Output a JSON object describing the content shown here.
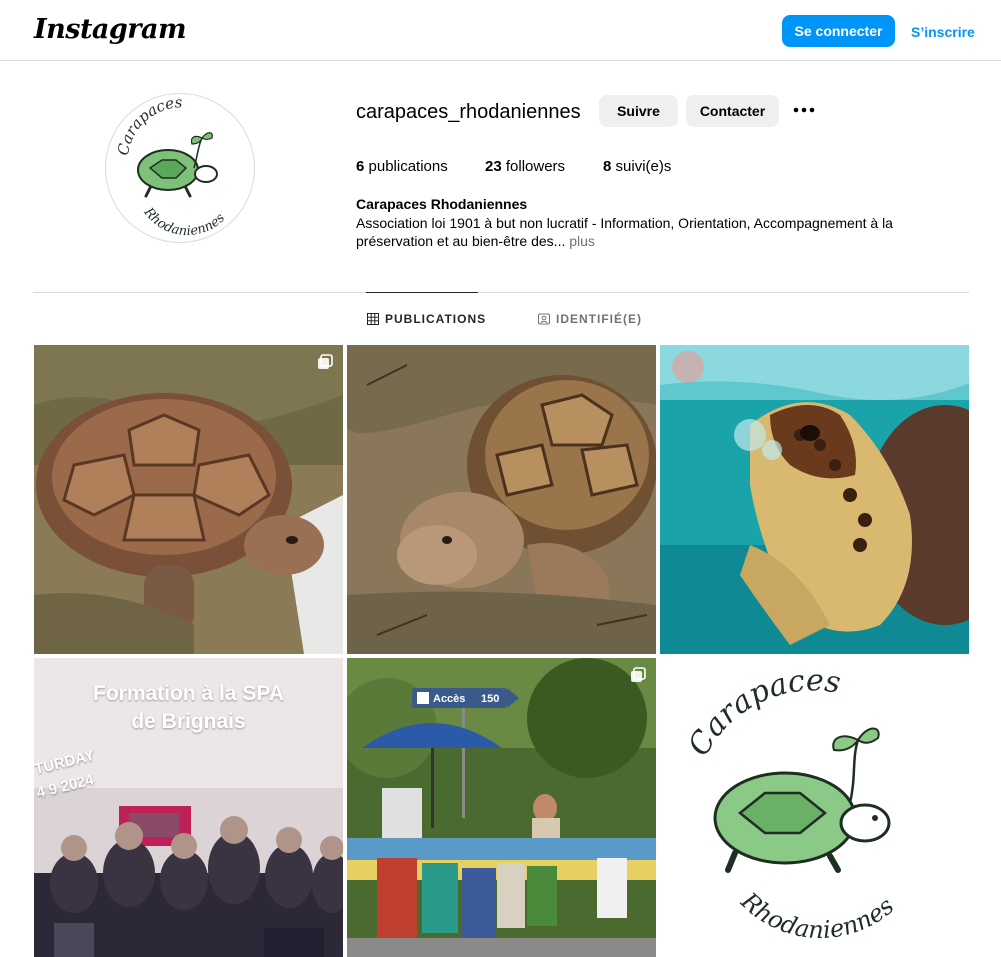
{
  "nav": {
    "logo": "Instagram",
    "login_label": "Se connecter",
    "signup_label": "S’inscrire",
    "accent_color": "#0095f6"
  },
  "profile": {
    "username": "carapaces_rhodaniennes",
    "follow_label": "Suivre",
    "contact_label": "Contacter",
    "more_icon": "more-horizontal-icon",
    "stats": {
      "posts_count": "6",
      "posts_label": "publications",
      "followers_count": "23",
      "followers_label": "followers",
      "following_count": "8",
      "following_label": "suivi(e)s"
    },
    "display_name": "Carapaces Rhodaniennes",
    "bio": "Association loi 1901 à but non lucratif - Information, Orientation, Accompagnement à la préservation et au bien-être des...",
    "bio_more": "plus",
    "avatar": {
      "word_top": "Carapaces",
      "word_bottom": "Rhodaniennes"
    }
  },
  "tabs": [
    {
      "label": "PUBLICATIONS",
      "icon": "grid-icon",
      "active": true
    },
    {
      "label": "IDENTIFIÉ(E)",
      "icon": "tagged-user-icon",
      "active": false
    }
  ],
  "posts": [
    {
      "subject": "tortoise-in-grass",
      "multi": true
    },
    {
      "subject": "tortoise-on-ground",
      "multi": false
    },
    {
      "subject": "sea-turtle-underwater",
      "multi": false
    },
    {
      "subject": "training-group-photo",
      "multi": false,
      "caption_line1": "Formation à la SPA",
      "caption_line2": "de Brignais",
      "sticker_day": "TURDAY",
      "sticker_date": "4 9 2024"
    },
    {
      "subject": "market-stand",
      "multi": true,
      "sign_text": "Accès",
      "sign_number": "150"
    },
    {
      "subject": "association-logo",
      "multi": false,
      "word_top": "Carapaces",
      "word_bottom": "Rhodaniennes"
    }
  ]
}
